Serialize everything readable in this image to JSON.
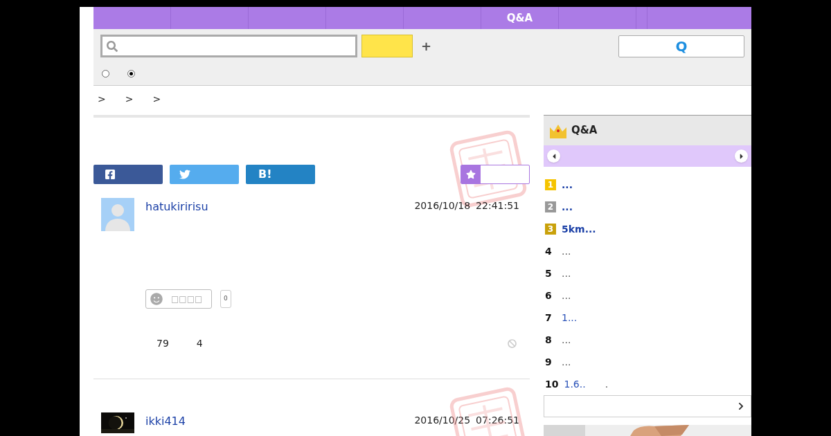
{
  "nav": {
    "tabs": [
      {
        "label": "Q&A"
      }
    ]
  },
  "search": {
    "q_button": "Q",
    "plus": "+",
    "radios": [
      {
        "selected": false
      },
      {
        "selected": true
      }
    ]
  },
  "breadcrumb": [
    ">",
    ">",
    ">"
  ],
  "share": {
    "hatena": "B!"
  },
  "posts": [
    {
      "user": "hatukiririsu",
      "date": "2016/10/18",
      "time": "22:41:51",
      "like_label": "□□□□",
      "like_count": "0",
      "views": "79",
      "answers": "4"
    },
    {
      "user": "ikki414",
      "date": "2016/10/25",
      "time": "07:26:51"
    }
  ],
  "ranking": {
    "title": "Q&A",
    "items": [
      {
        "rank": "1",
        "kind": "medal",
        "color": "#f5c400",
        "text": "..."
      },
      {
        "rank": "2",
        "kind": "medal",
        "color": "#999999",
        "text": "..."
      },
      {
        "rank": "3",
        "kind": "medal",
        "color": "#c9a10a",
        "text": "5km..."
      },
      {
        "rank": "4",
        "kind": "plain",
        "text": "..."
      },
      {
        "rank": "5",
        "kind": "plain",
        "text": "..."
      },
      {
        "rank": "6",
        "kind": "plain",
        "text": "..."
      },
      {
        "rank": "7",
        "kind": "link",
        "text": "1..."
      },
      {
        "rank": "8",
        "kind": "plain",
        "text": "..."
      },
      {
        "rank": "9",
        "kind": "plain",
        "text": "..."
      },
      {
        "rank": "10",
        "kind": "link",
        "text": "1.6..",
        "suffix": "."
      }
    ]
  }
}
